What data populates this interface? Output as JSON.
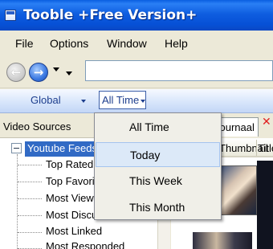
{
  "window": {
    "title": "Tooble +Free Version+"
  },
  "menubar": {
    "items": [
      "File",
      "Options",
      "Window",
      "Help"
    ]
  },
  "address": {
    "value": "",
    "placeholder": ""
  },
  "filters": {
    "scope": "Global",
    "time": "All Time",
    "time_options": [
      "All Time",
      "Today",
      "This Week",
      "This Month"
    ],
    "highlighted_option": "Today"
  },
  "sources": {
    "title": "Video Sources",
    "root": "Youtube Feeds",
    "children": [
      "Top Rated",
      "Top Favorites",
      "Most Viewed",
      "Most Discussed",
      "Most Linked",
      "Most Responded"
    ]
  },
  "content": {
    "tab_label": "Journaal",
    "columns": [
      "Thumbnail",
      "Title"
    ]
  },
  "colors": {
    "titlebar": "#0a5fe0",
    "selection": "#316ac5",
    "dropdown_hover": "#dce9f8",
    "close_red": "#e01e1e"
  }
}
